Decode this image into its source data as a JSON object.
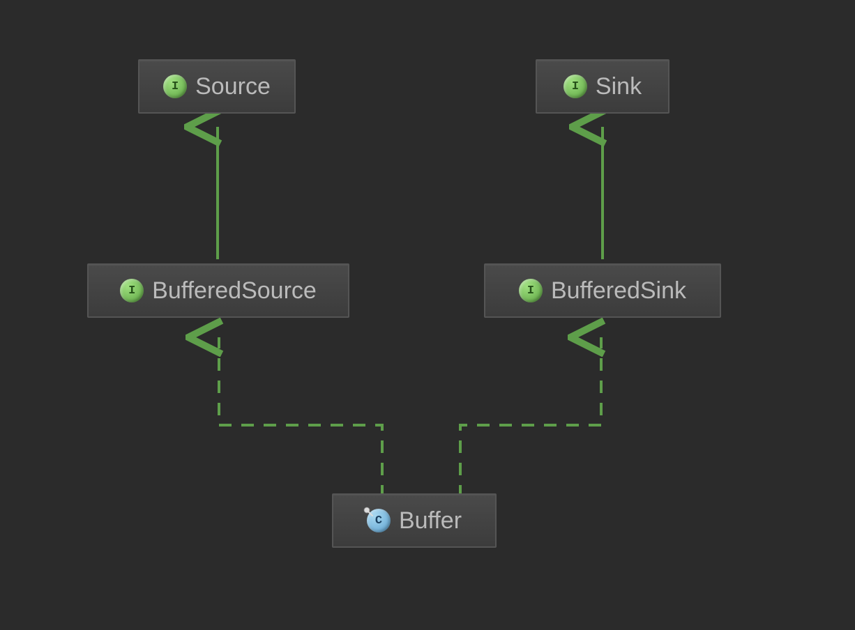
{
  "diagram": {
    "nodes": {
      "source": {
        "label": "Source",
        "iconLetter": "I",
        "iconType": "interface"
      },
      "sink": {
        "label": "Sink",
        "iconLetter": "I",
        "iconType": "interface"
      },
      "bufferedSource": {
        "label": "BufferedSource",
        "iconLetter": "I",
        "iconType": "interface"
      },
      "bufferedSink": {
        "label": "BufferedSink",
        "iconLetter": "I",
        "iconType": "interface"
      },
      "buffer": {
        "label": "Buffer",
        "iconLetter": "C",
        "iconType": "class"
      }
    },
    "colors": {
      "background": "#2b2b2b",
      "nodeBg": "#3c3c3c",
      "nodeBorder": "#555555",
      "text": "#bbbbbb",
      "arrow": "#5e9e4a",
      "interfaceIcon": "#7ac65a",
      "classIcon": "#6fb8e0"
    },
    "relations": [
      {
        "from": "bufferedSource",
        "to": "source",
        "style": "solid"
      },
      {
        "from": "bufferedSink",
        "to": "sink",
        "style": "solid"
      },
      {
        "from": "buffer",
        "to": "bufferedSource",
        "style": "dashed"
      },
      {
        "from": "buffer",
        "to": "bufferedSink",
        "style": "dashed"
      }
    ]
  }
}
